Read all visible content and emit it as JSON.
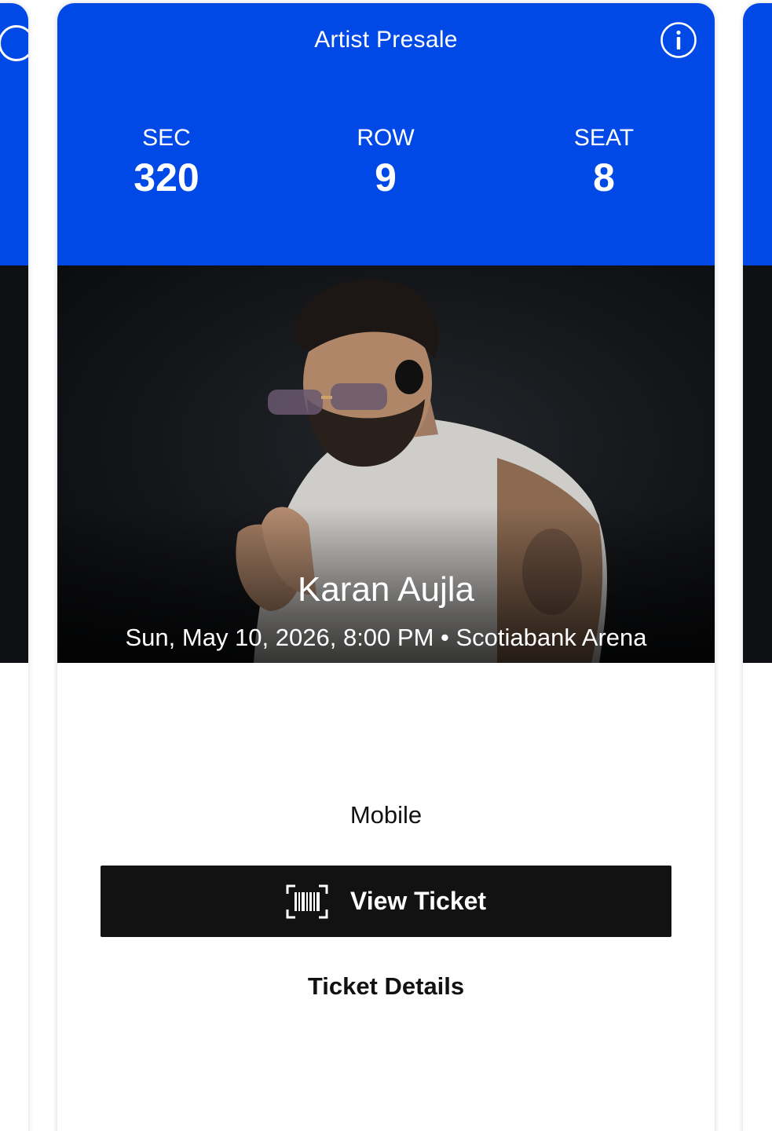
{
  "theme": {
    "accent": "#0049e6",
    "button_bg": "#121212"
  },
  "ticket": {
    "title": "Artist Presale",
    "info_icon": "info-circle-icon",
    "sec_label": "SEC",
    "sec_value": "320",
    "row_label": "ROW",
    "row_value": "9",
    "seat_label": "SEAT",
    "seat_value": "8",
    "artist": "Karan Aujla",
    "event_line": "Sun, May 10, 2026, 8:00 PM • Scotiabank Arena",
    "delivery_method": "Mobile",
    "view_ticket_label": "View Ticket",
    "view_ticket_icon": "barcode-scan-icon",
    "ticket_details_label": "Ticket Details"
  }
}
